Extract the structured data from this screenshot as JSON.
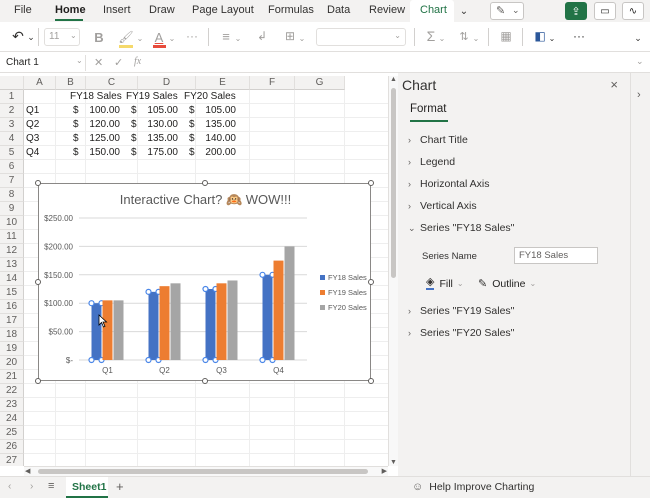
{
  "ribbon": {
    "tabs": [
      "File",
      "Home",
      "Insert",
      "Draw",
      "Page Layout",
      "Formulas",
      "Data",
      "Review",
      "Chart"
    ],
    "active_tab": "Home",
    "contextual_tab": "Chart",
    "font_size": "11",
    "more": "···"
  },
  "formula_bar": {
    "name_box": "Chart 1",
    "fx": "fx",
    "value": ""
  },
  "sheet": {
    "columns": [
      "A",
      "B",
      "C",
      "D",
      "E",
      "F",
      "G"
    ],
    "rows": [
      "1",
      "2",
      "3",
      "4",
      "5",
      "6",
      "7",
      "8",
      "9",
      "10",
      "11",
      "12",
      "13",
      "14",
      "15",
      "16",
      "17",
      "18",
      "19",
      "20",
      "21",
      "22",
      "23",
      "24",
      "25",
      "26",
      "27"
    ],
    "headers": [
      "FY18 Sales",
      "FY19 Sales",
      "FY20 Sales"
    ],
    "data": [
      {
        "label": "Q1",
        "v": [
          "100.00",
          "105.00",
          "105.00"
        ]
      },
      {
        "label": "Q2",
        "v": [
          "120.00",
          "130.00",
          "135.00"
        ]
      },
      {
        "label": "Q3",
        "v": [
          "125.00",
          "135.00",
          "140.00"
        ]
      },
      {
        "label": "Q4",
        "v": [
          "150.00",
          "175.00",
          "200.00"
        ]
      }
    ],
    "currency": "$"
  },
  "chart_data": {
    "type": "bar",
    "title": "Interactive Chart? 🙉 WOW!!!",
    "categories": [
      "Q1",
      "Q2",
      "Q3",
      "Q4"
    ],
    "series": [
      {
        "name": "FY18 Sales",
        "values": [
          100,
          120,
          125,
          150
        ],
        "color": "#4472c4"
      },
      {
        "name": "FY19 Sales",
        "values": [
          105,
          130,
          135,
          175
        ],
        "color": "#ed7d31"
      },
      {
        "name": "FY20 Sales",
        "values": [
          105,
          135,
          140,
          200
        ],
        "color": "#a5a5a5"
      }
    ],
    "ylim": [
      0,
      250
    ],
    "yticks": [
      0,
      50,
      100,
      150,
      200,
      250
    ],
    "ytick_labels": [
      "$-",
      "$50.00",
      "$100.00",
      "$150.00",
      "$200.00",
      "$250.00"
    ],
    "grid": true,
    "legend": "right",
    "selected_series": "FY18 Sales"
  },
  "pane": {
    "title": "Chart",
    "tab": "Format",
    "sections": [
      "Chart Title",
      "Legend",
      "Horizontal Axis",
      "Vertical Axis"
    ],
    "expanded_section": "Series \"FY18 Sales\"",
    "series_name_label": "Series Name",
    "series_name_value": "FY18 Sales",
    "fill": "Fill",
    "outline": "Outline",
    "other_sections": [
      "Series \"FY19 Sales\"",
      "Series \"FY20 Sales\""
    ],
    "help": "Help Improve Charting"
  },
  "sheet_tabs": {
    "active": "Sheet1",
    "add": "+"
  },
  "colors": {
    "accent": "#217346",
    "selection": "#1a73e8"
  }
}
